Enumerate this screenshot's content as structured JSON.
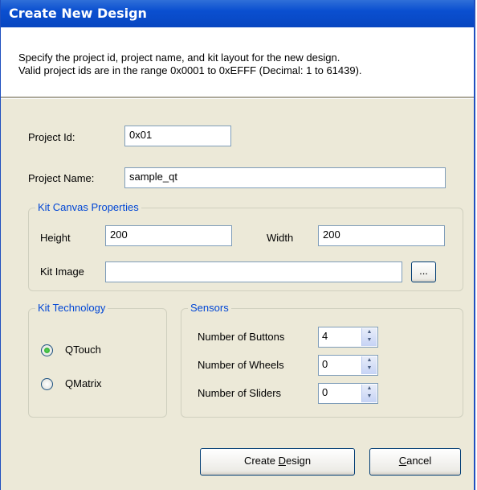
{
  "window": {
    "title": "Create New Design"
  },
  "header": {
    "line1": "Specify the project id, project name, and kit layout for the new design.",
    "line2": "Valid project ids are in the range 0x0001 to 0xEFFF (Decimal: 1 to 61439)."
  },
  "project": {
    "id_label": "Project Id:",
    "id_value": "0x01",
    "name_label": "Project Name:",
    "name_value": "sample_qt"
  },
  "kit_canvas": {
    "title": "Kit Canvas Properties",
    "height_label": "Height",
    "height_value": "200",
    "width_label": "Width",
    "width_value": "200",
    "image_label": "Kit Image",
    "image_value": "",
    "browse_label": "..."
  },
  "kit_technology": {
    "title": "Kit Technology",
    "options": [
      {
        "label": "QTouch",
        "selected": true
      },
      {
        "label": "QMatrix",
        "selected": false
      }
    ]
  },
  "sensors": {
    "title": "Sensors",
    "rows": [
      {
        "label": "Number of Buttons",
        "value": "4"
      },
      {
        "label": "Number of Wheels",
        "value": "0"
      },
      {
        "label": "Number of Sliders",
        "value": "0"
      }
    ]
  },
  "buttons": {
    "create_label": "Create Design",
    "create_mnemonic": "D",
    "cancel_label": "Cancel",
    "cancel_mnemonic": "C"
  },
  "colors": {
    "title_bar": "#0a4fd0",
    "group_title": "#0046d5",
    "dialog_bg": "#ece9d8"
  }
}
